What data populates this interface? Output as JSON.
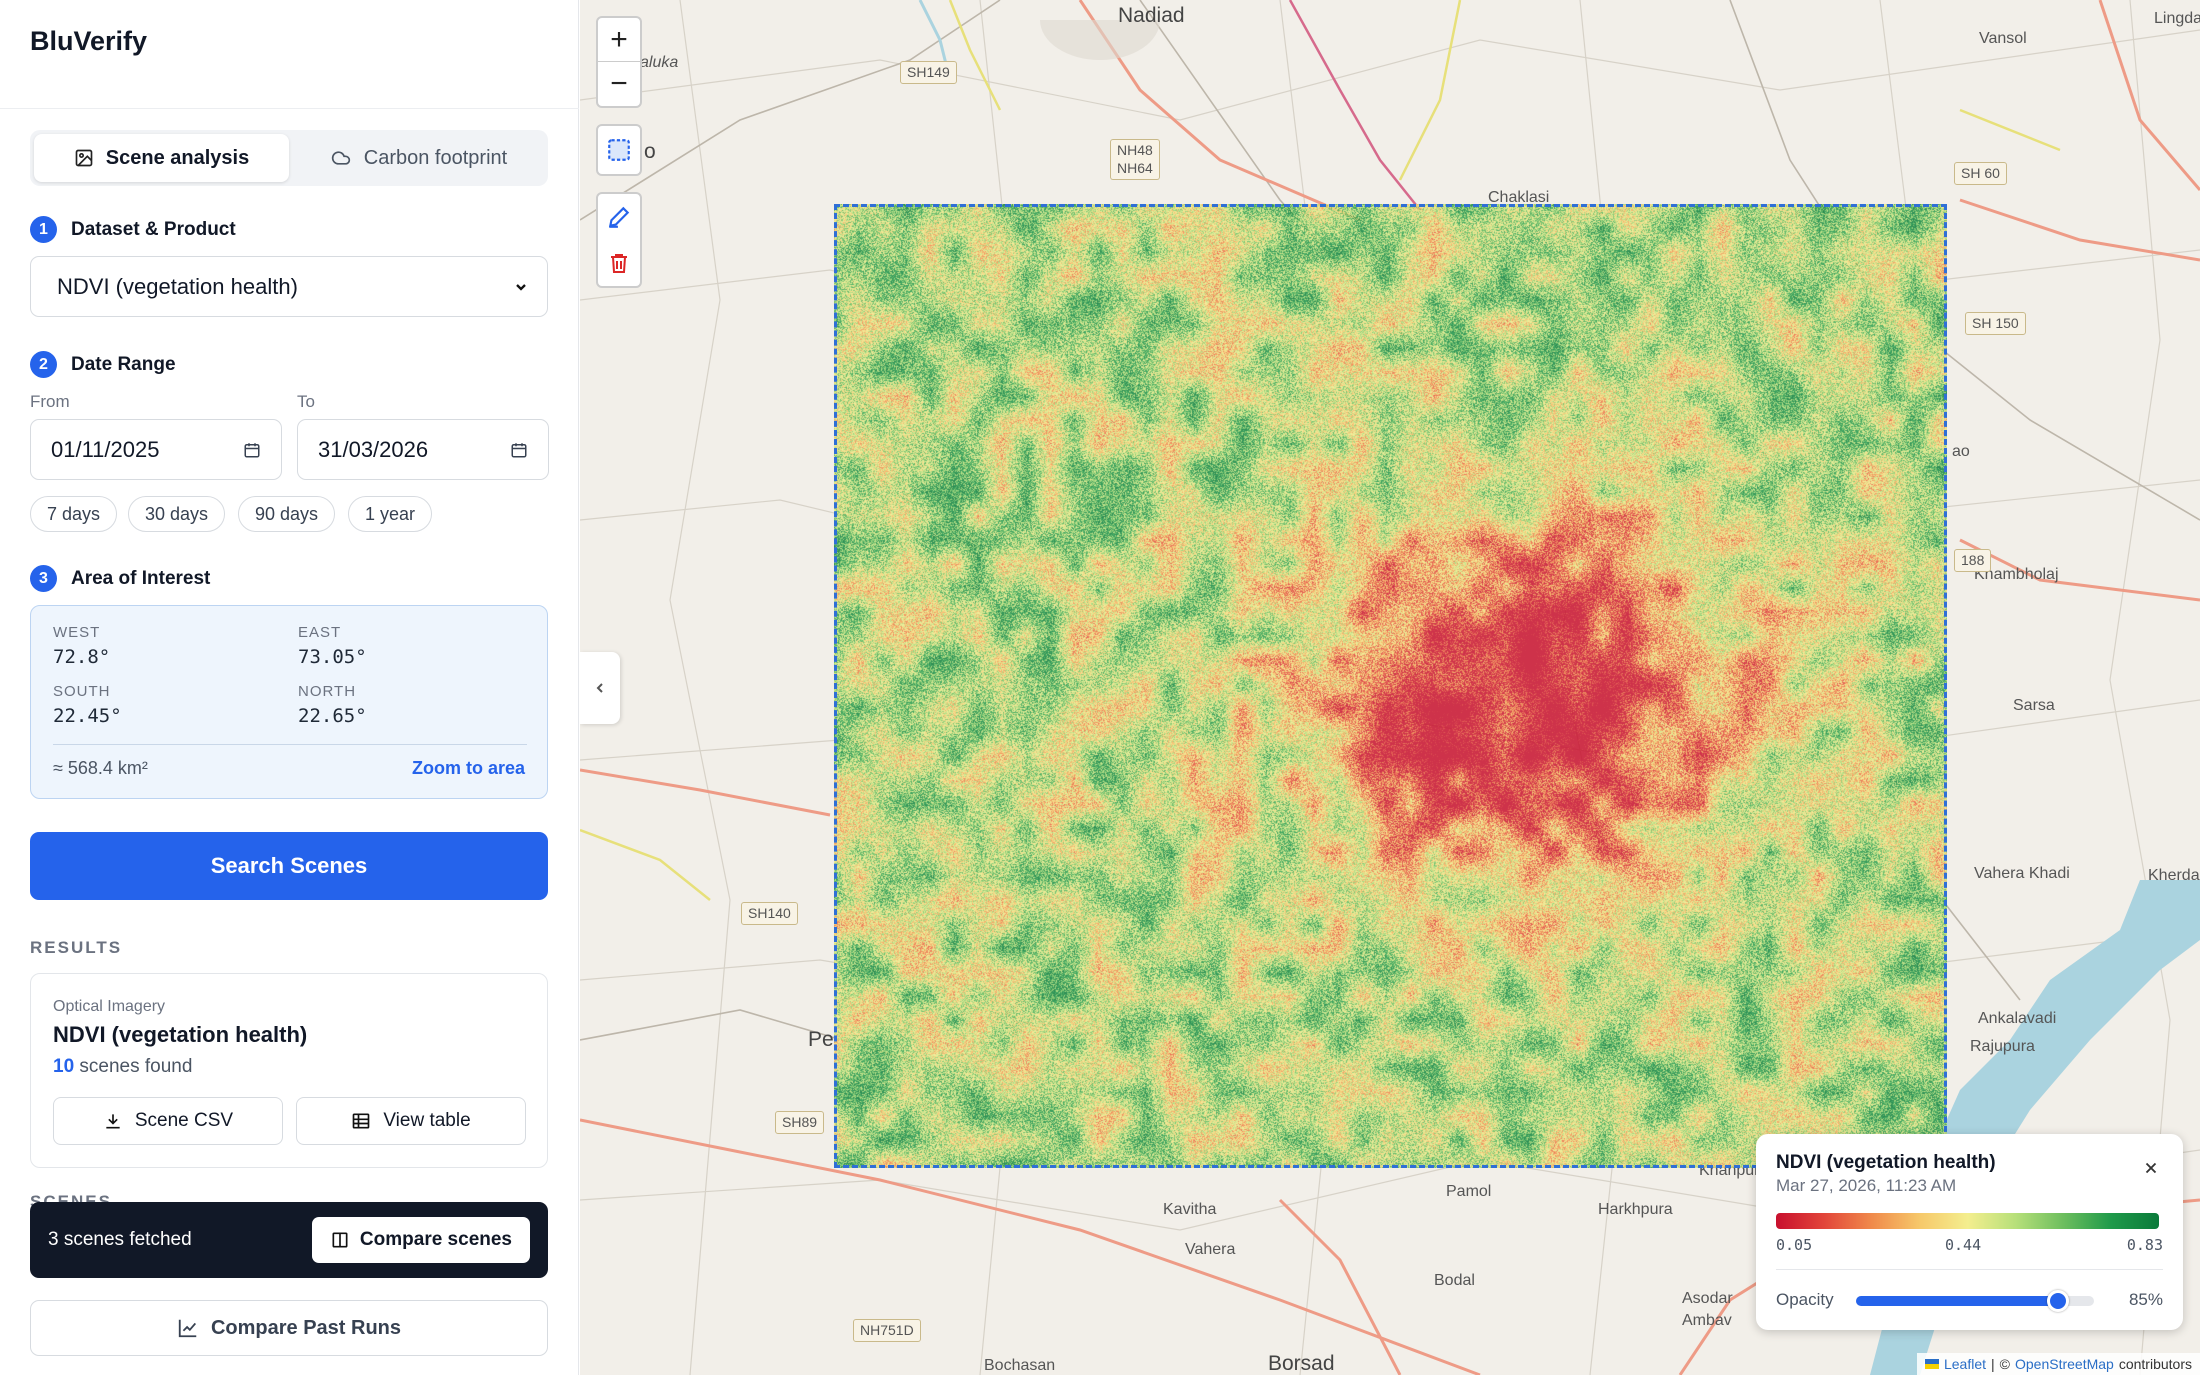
{
  "app": {
    "title": "BluVerify"
  },
  "mode_tabs": [
    {
      "label": "Scene analysis",
      "icon": "image-icon",
      "active": true
    },
    {
      "label": "Carbon footprint",
      "icon": "cloud-icon",
      "active": false
    }
  ],
  "dataset": {
    "step": "1",
    "heading": "Dataset & Product",
    "selected": "NDVI (vegetation health)"
  },
  "date_range": {
    "step": "2",
    "heading": "Date Range",
    "from_label": "From",
    "from_value": "01/11/2025",
    "to_label": "To",
    "to_value": "31/03/2026",
    "presets": [
      "7 days",
      "30 days",
      "90 days",
      "1 year"
    ]
  },
  "aoi": {
    "step": "3",
    "heading": "Area of Interest",
    "west_label": "WEST",
    "west": "72.8°",
    "east_label": "EAST",
    "east": "73.05°",
    "south_label": "SOUTH",
    "south": "22.45°",
    "north_label": "NORTH",
    "north": "22.65°",
    "area": "≈ 568.4 km²",
    "zoom_link": "Zoom to area"
  },
  "search_button": "Search Scenes",
  "results": {
    "heading": "RESULTS",
    "category": "Optical Imagery",
    "title": "NDVI (vegetation health)",
    "count": "10",
    "count_suffix": " scenes found",
    "csv_button": "Scene CSV",
    "table_button": "View table",
    "scenes_heading": "SCENES"
  },
  "toast": {
    "text": "3 scenes fetched",
    "button": "Compare scenes"
  },
  "past_runs_button": "Compare Past Runs",
  "map": {
    "zoom_in": "+",
    "zoom_out": "−",
    "places": [
      "Nadiad",
      "Vansol",
      "Lingda",
      "Chaklasi",
      "Khambholaj",
      "Sarsa",
      "Vahera Khadi",
      "Kherda",
      "Ankalavadi",
      "Rajupura",
      "Kavitha",
      "Vahera",
      "Pamol",
      "Harkhpura",
      "Bodal",
      "Asodar",
      "Ambav",
      "Borsad",
      "Bochasan",
      "Khanpur",
      "Pe",
      "aluka",
      "o",
      "ao"
    ],
    "road_shields": [
      "SH149",
      "NH48",
      "NH64",
      "SH 60",
      "SH 150",
      "188",
      "SH140",
      "SH89",
      "NH751D"
    ],
    "attribution": {
      "leaflet": "Leaflet",
      "separator": "|",
      "copyright": "©",
      "osm": "OpenStreetMap",
      "contributors": "contributors"
    }
  },
  "legend": {
    "title": "NDVI (vegetation health)",
    "date": "Mar 27, 2026, 11:23 AM",
    "min": "0.05",
    "mid": "0.44",
    "max": "0.83",
    "opacity_label": "Opacity",
    "opacity_value": "85%",
    "opacity_fraction": 0.85
  },
  "colors": {
    "accent": "#2563eb",
    "ndvi_low": "#c8102e",
    "ndvi_mid": "#f4ee8e",
    "ndvi_high": "#0a7a3a"
  }
}
